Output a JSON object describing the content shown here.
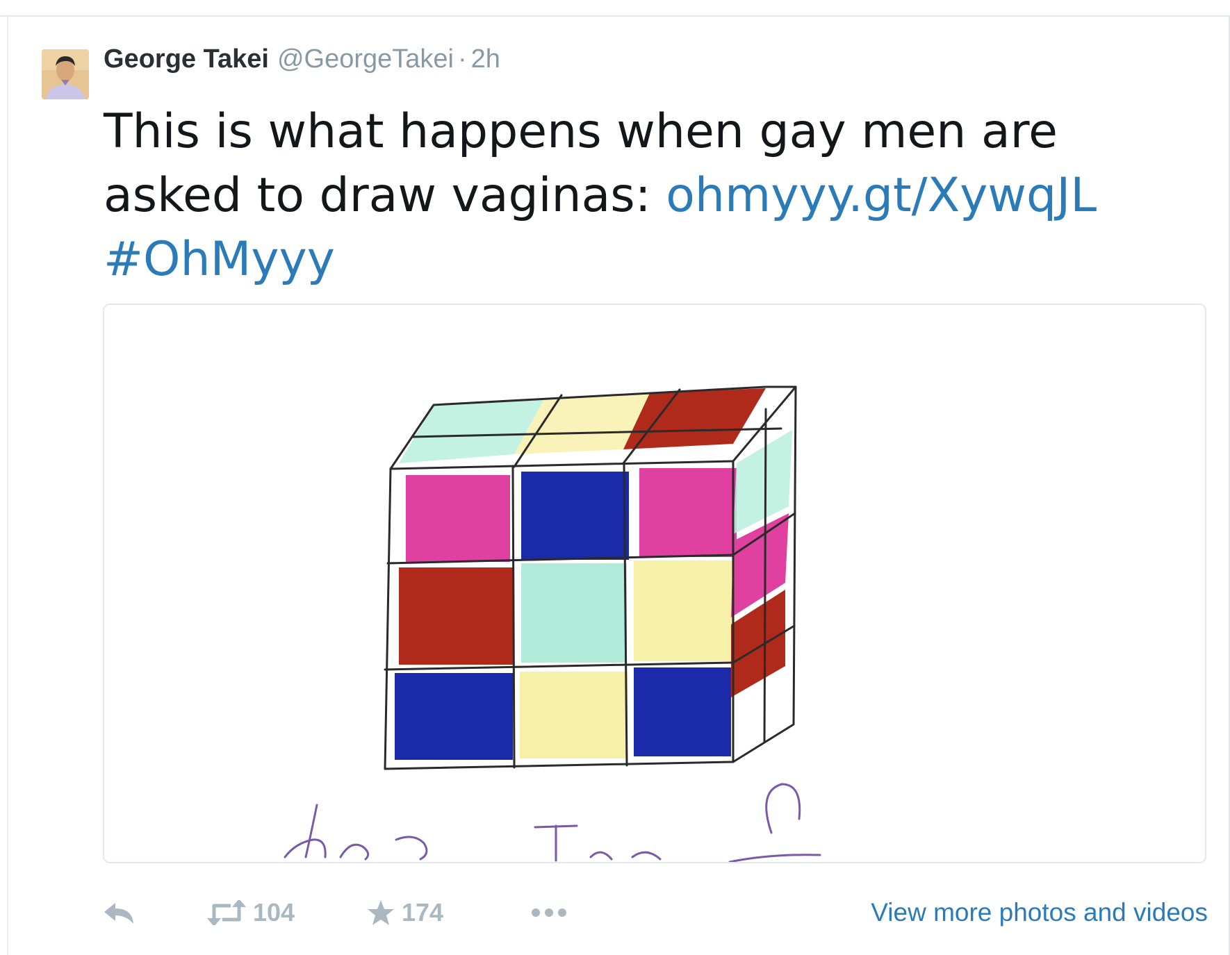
{
  "tweet": {
    "fullname": "George Takei",
    "username": "@GeorgeTakei",
    "separator": "·",
    "time": "2h",
    "text_plain": "This is what happens when gay men are asked to draw vaginas: ",
    "link_text": "ohmyyy.gt/XywqJL",
    "hashtag": "#OhMyyy",
    "link_color": "#2b7bb9"
  },
  "actions": {
    "reply_icon": "reply-icon",
    "retweet_icon": "retweet-icon",
    "retweet_count": "104",
    "favorite_icon": "star-icon",
    "favorite_count": "174",
    "more_icon": "more-dots-icon",
    "view_more": "View more photos and videos"
  },
  "media": {
    "description_icon": "rubiks-cube-drawing",
    "colors": {
      "red": "#b02a1c",
      "pink": "#e0409f",
      "blue": "#1b2aa8",
      "mint": "#a9ead6",
      "yellow": "#f7f0a8",
      "signature": "#7a5aa8"
    }
  }
}
